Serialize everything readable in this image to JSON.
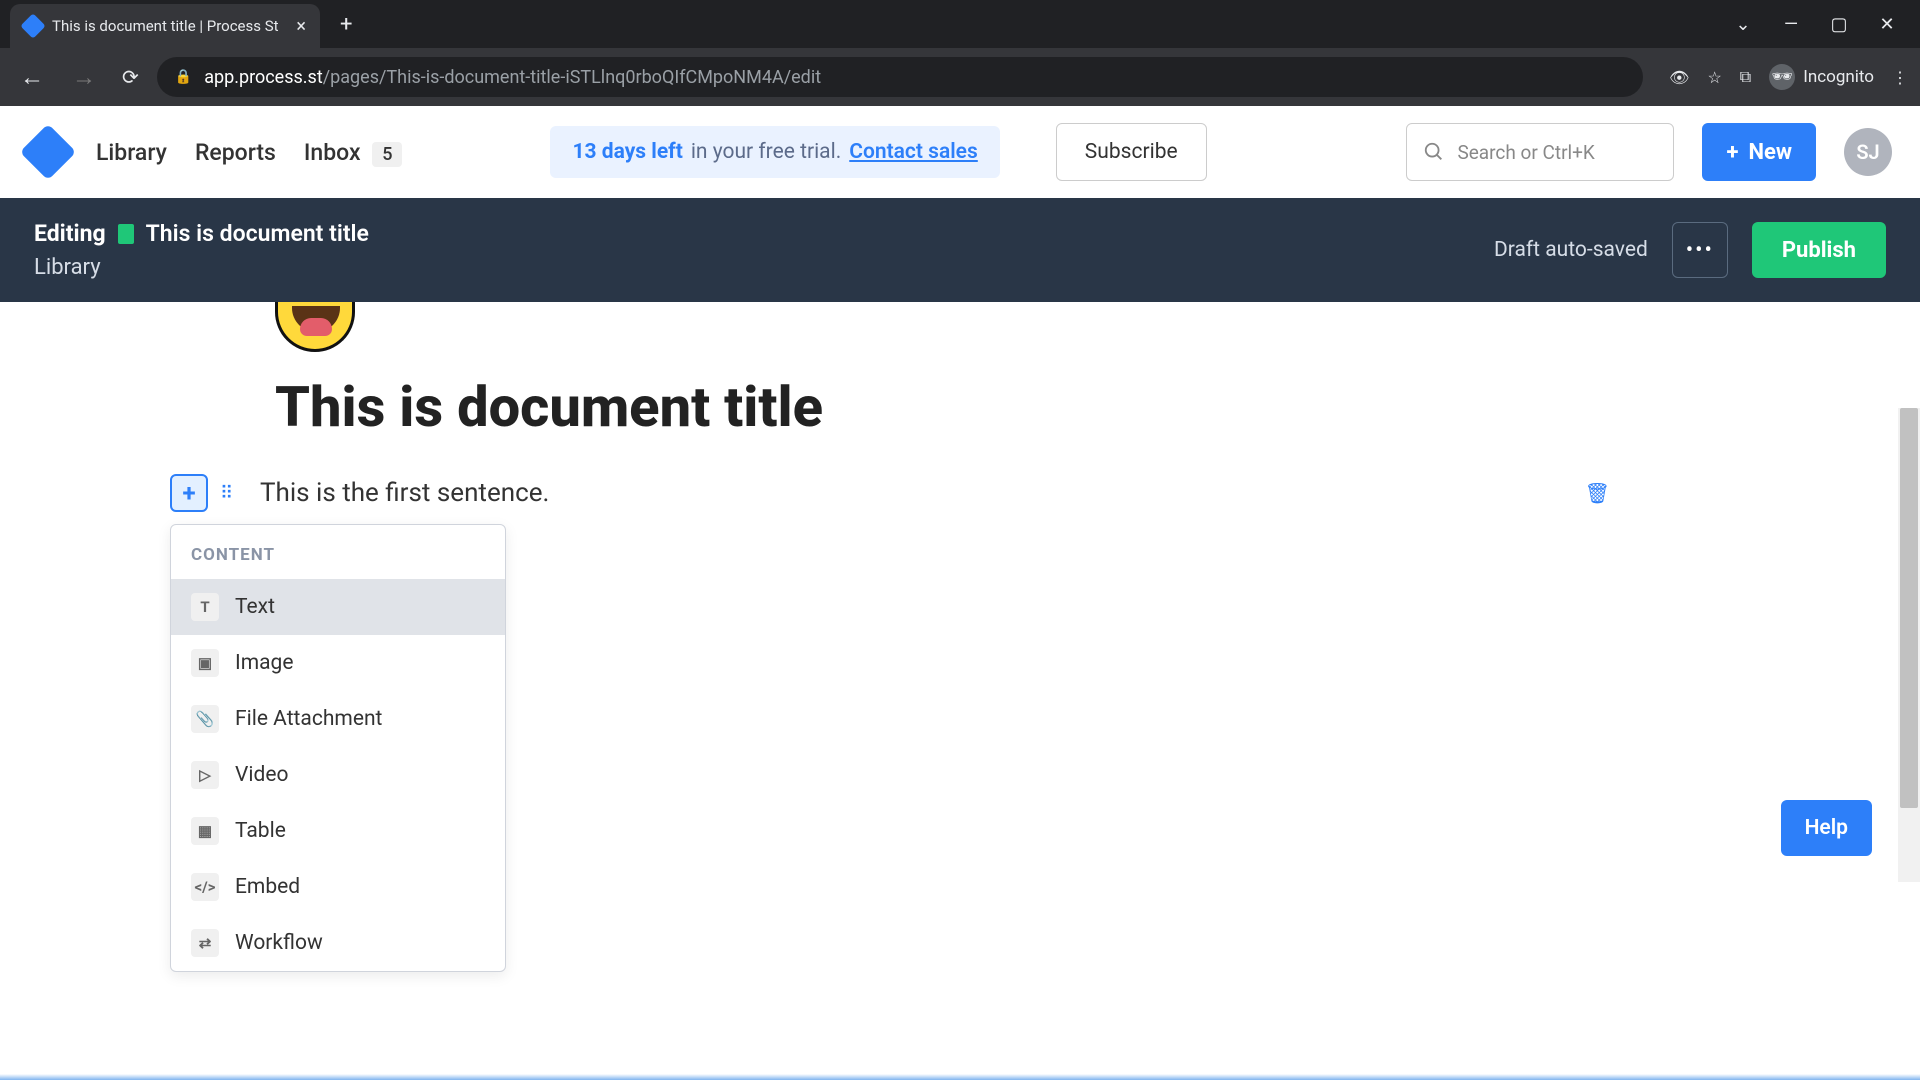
{
  "browser": {
    "tab_title": "This is document title | Process St",
    "url_domain": "app.process.st",
    "url_path": "/pages/This-is-document-title-iSTLlnq0rboQIfCMpoNM4A/edit",
    "incognito_label": "Incognito"
  },
  "header": {
    "nav_library": "Library",
    "nav_reports": "Reports",
    "nav_inbox": "Inbox",
    "inbox_count": "5",
    "trial_days": "13 days left",
    "trial_rest": "in your free trial.",
    "contact_sales": "Contact sales",
    "subscribe_label": "Subscribe",
    "search_placeholder": "Search or Ctrl+K",
    "new_label": "New",
    "avatar_initials": "SJ"
  },
  "editing_bar": {
    "editing_label": "Editing",
    "doc_title": "This is document title",
    "breadcrumb": "Library",
    "autosave": "Draft auto-saved",
    "publish_label": "Publish"
  },
  "document": {
    "title": "This is document title",
    "first_block": "This is the first sentence."
  },
  "content_menu": {
    "header": "CONTENT",
    "items": [
      {
        "label": "Text",
        "icon": "T"
      },
      {
        "label": "Image",
        "icon": "▣"
      },
      {
        "label": "File Attachment",
        "icon": "📎"
      },
      {
        "label": "Video",
        "icon": "▷"
      },
      {
        "label": "Table",
        "icon": "▦"
      },
      {
        "label": "Embed",
        "icon": "</>"
      },
      {
        "label": "Workflow",
        "icon": "⇄"
      }
    ]
  },
  "help_label": "Help"
}
